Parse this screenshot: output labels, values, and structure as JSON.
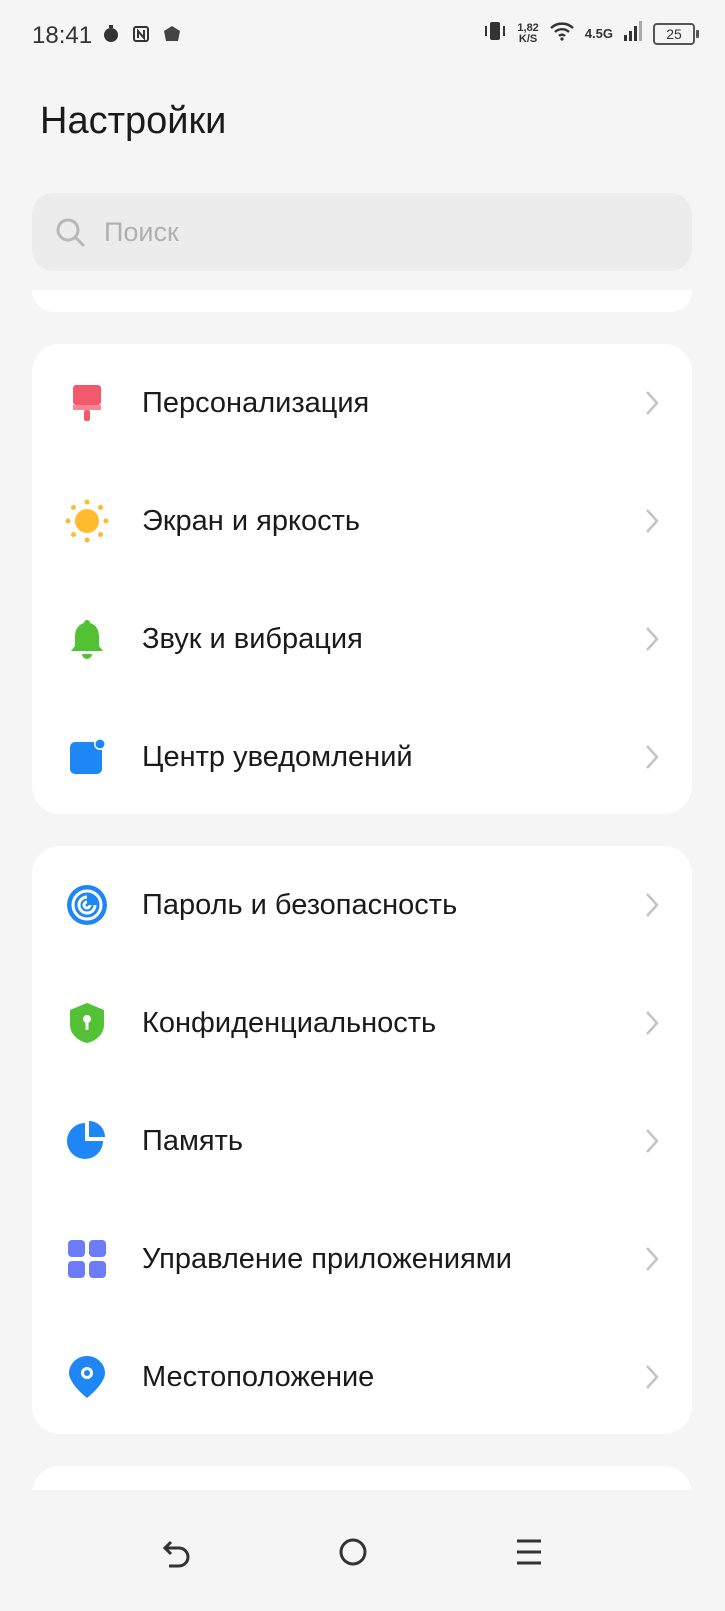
{
  "status_bar": {
    "time": "18:41",
    "speed_value": "1,82",
    "speed_unit": "K/S",
    "network": "4.5G",
    "battery": "25",
    "left_icons": [
      "timer-icon",
      "nfc-icon",
      "app-notification-icon"
    ],
    "right_icons": [
      "vibrate-icon",
      "wifi-icon",
      "signal-icon",
      "battery-icon"
    ]
  },
  "page": {
    "title": "Настройки"
  },
  "search": {
    "placeholder": "Поиск",
    "value": ""
  },
  "groups": [
    {
      "items": [
        {
          "id": "personalization",
          "label": "Персонализация",
          "icon": "paint-brush-icon",
          "color": "#f25a6b"
        },
        {
          "id": "display",
          "label": "Экран и яркость",
          "icon": "sun-icon",
          "color": "#ffb300"
        },
        {
          "id": "sound",
          "label": "Звук и вибрация",
          "icon": "bell-icon",
          "color": "#52c234"
        },
        {
          "id": "notifications",
          "label": "Центр уведомлений",
          "icon": "notification-center-icon",
          "color": "#1f87f5"
        }
      ]
    },
    {
      "items": [
        {
          "id": "password",
          "label": "Пароль и безопасность",
          "icon": "fingerprint-icon",
          "color": "#1f87f5"
        },
        {
          "id": "privacy",
          "label": "Конфиденциальность",
          "icon": "shield-icon",
          "color": "#52c234"
        },
        {
          "id": "storage",
          "label": "Память",
          "icon": "pie-chart-icon",
          "color": "#1f87f5"
        },
        {
          "id": "apps",
          "label": "Управление приложениями",
          "icon": "apps-grid-icon",
          "color": "#6b7cf6"
        },
        {
          "id": "location",
          "label": "Местоположение",
          "icon": "location-pin-icon",
          "color": "#1f87f5"
        }
      ]
    }
  ],
  "nav_bar": {
    "buttons": [
      "back-icon",
      "home-icon",
      "menu-icon"
    ]
  }
}
